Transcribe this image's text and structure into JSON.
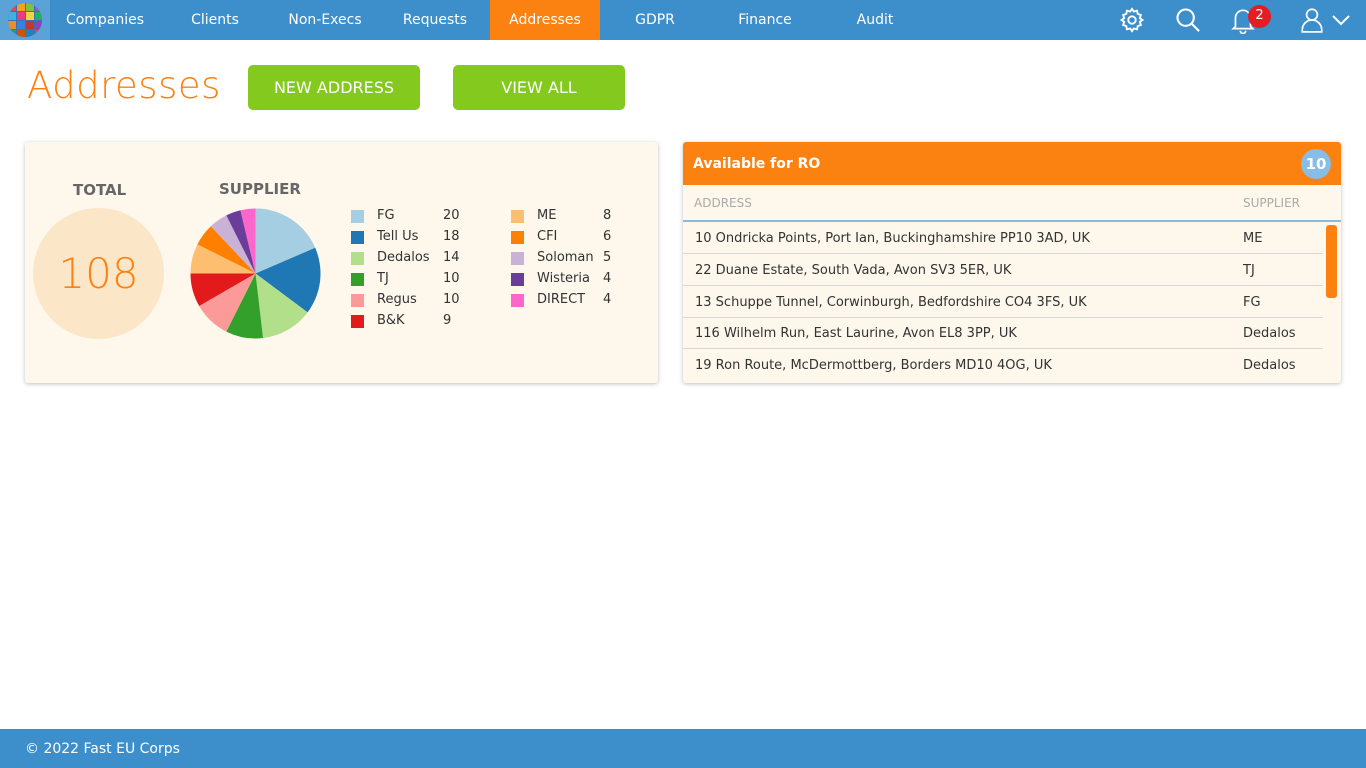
{
  "nav": {
    "items": [
      "Companies",
      "Clients",
      "Non-Execs",
      "Requests",
      "Addresses",
      "GDPR",
      "Finance",
      "Audit"
    ],
    "active_index": 4,
    "notification_count": "2"
  },
  "header": {
    "title": "Addresses",
    "new_button": "NEW ADDRESS",
    "view_all_button": "VIEW ALL"
  },
  "stats": {
    "total_label": "TOTAL",
    "total_value": "108",
    "supplier_label": "SUPPLIER"
  },
  "chart_data": {
    "type": "pie",
    "title": "SUPPLIER",
    "slices": [
      {
        "label": "FG",
        "value": 20,
        "color": "#a6cee3"
      },
      {
        "label": "Tell Us",
        "value": 18,
        "color": "#1f78b4"
      },
      {
        "label": "Dedalos",
        "value": 14,
        "color": "#b2df8a"
      },
      {
        "label": "TJ",
        "value": 10,
        "color": "#33a02c"
      },
      {
        "label": "Regus",
        "value": 10,
        "color": "#fb9a99"
      },
      {
        "label": "B&K",
        "value": 9,
        "color": "#e31a1c"
      },
      {
        "label": "ME",
        "value": 8,
        "color": "#fdbf6f"
      },
      {
        "label": "CFI",
        "value": 6,
        "color": "#ff7f00"
      },
      {
        "label": "Soloman",
        "value": 5,
        "color": "#cab2d6"
      },
      {
        "label": "Wisteria",
        "value": 4,
        "color": "#6a3d9a"
      },
      {
        "label": "DIRECT",
        "value": 4,
        "color": "#ff66cc"
      }
    ]
  },
  "addresses": {
    "title": "Available for RO",
    "count": "10",
    "col_address": "ADDRESS",
    "col_supplier": "SUPPLIER",
    "rows": [
      {
        "address": "10 Ondricka Points, Port Ian, Buckinghamshire PP10 3AD, UK",
        "supplier": "ME"
      },
      {
        "address": "22 Duane Estate, South Vada, Avon SV3 5ER, UK",
        "supplier": "TJ"
      },
      {
        "address": "13 Schuppe Tunnel, Corwinburgh, Bedfordshire CO4 3FS, UK",
        "supplier": "FG"
      },
      {
        "address": "116 Wilhelm Run, East Laurine, Avon EL8 3PP, UK",
        "supplier": "Dedalos"
      },
      {
        "address": "19 Ron Route, McDermottberg, Borders MD10 4OG, UK",
        "supplier": "Dedalos"
      }
    ]
  },
  "footer": {
    "copyright": "© 2022 Fast EU Corps"
  }
}
